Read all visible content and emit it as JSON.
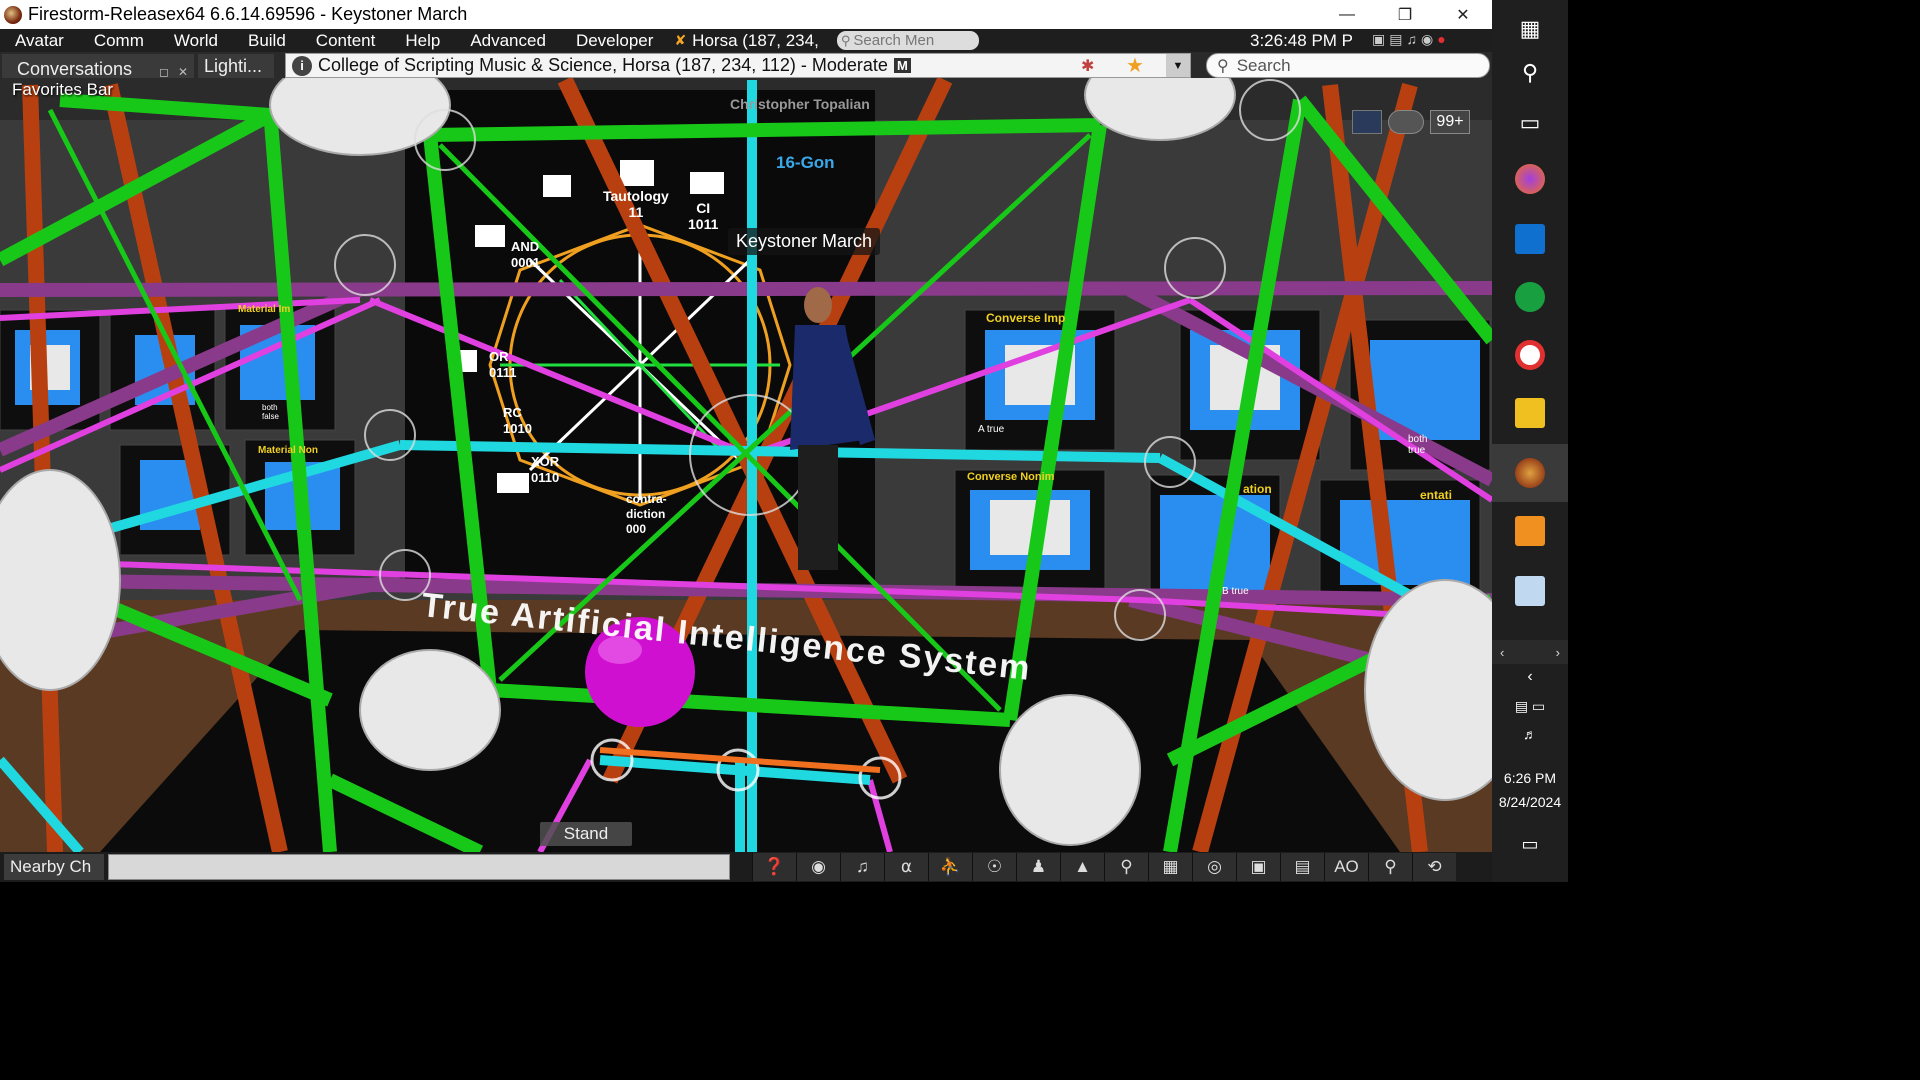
{
  "window": {
    "title": "Firestorm-Releasex64 6.6.14.69596 - Keystoner March",
    "minimize_icon": "minimize-icon",
    "restore_icon": "restore-icon",
    "close_icon": "close-icon"
  },
  "menu": {
    "items": [
      "Avatar",
      "Comm",
      "World",
      "Build",
      "Content",
      "Help",
      "Advanced",
      "Developer"
    ],
    "location": "Horsa (187, 234,",
    "search_placeholder": "Search Men",
    "clock": "3:26:48 PM P"
  },
  "nav": {
    "conversations_tab": "Conversations",
    "lighting_tab": "Lighti...",
    "location": "College of Scripting Music & Science, Horsa (187, 234, 112) - Moderate",
    "maturity_badge": "M",
    "search_placeholder": "Search",
    "favorites_bar": "Favorites Bar"
  },
  "hud": {
    "notification_count": "99+"
  },
  "scene": {
    "avatar_name": "Keystoner March",
    "stand_button": "Stand",
    "board_title": "16-Gon",
    "board_author": "Christopher Topalian",
    "labels": [
      {
        "text": "Tautology",
        "sub": "11"
      },
      {
        "text": "CI",
        "sub": "1011"
      },
      {
        "text": "AND",
        "sub": "0001"
      },
      {
        "text": "OR",
        "sub": "0111"
      },
      {
        "text": "RC",
        "sub": "1010"
      },
      {
        "text": "XOR",
        "sub": "0110"
      },
      {
        "text": "contra-diction",
        "sub": "000"
      }
    ],
    "floor_text": "True Artificial Intelligence System",
    "panel_labels": [
      "Material Im",
      "Material Non",
      "Converse Imp",
      "Converse Nonim",
      "ation",
      "entati"
    ],
    "tiny_labels": [
      "A true",
      "both false",
      "B true",
      "both true"
    ]
  },
  "bottom": {
    "nearby_chat": "Nearby Ch",
    "ao_label": "AO"
  },
  "taskbar": {
    "time": "6:26 PM",
    "date": "8/24/2024"
  },
  "colors": {
    "green": "#18c818",
    "magenta": "#e040e0",
    "purple": "#8a3a8a",
    "cyan": "#20d8e0",
    "orange": "#b84010",
    "ball": "#d010d0"
  }
}
